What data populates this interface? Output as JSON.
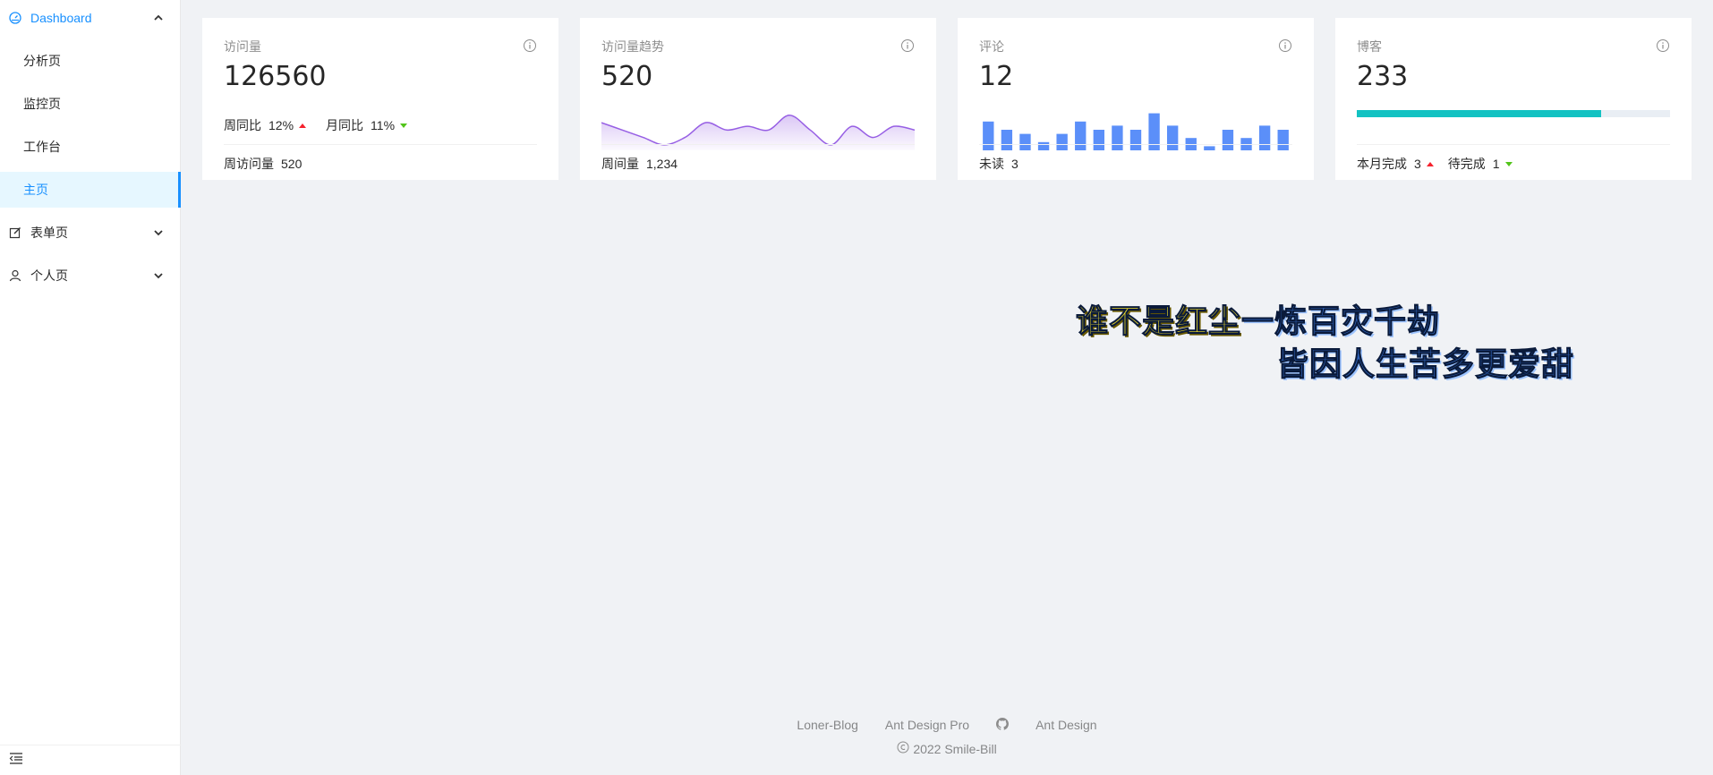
{
  "sidebar": {
    "dashboard_label": "Dashboard",
    "items": [
      {
        "label": "分析页"
      },
      {
        "label": "监控页"
      },
      {
        "label": "工作台"
      },
      {
        "label": "主页"
      }
    ],
    "form_label": "表单页",
    "profile_label": "个人页",
    "accent_color": "#1890ff"
  },
  "cards": {
    "visits": {
      "title": "访问量",
      "value": "126560",
      "week_label": "周同比",
      "week_value": "12%",
      "month_label": "月同比",
      "month_value": "11%",
      "footer_label": "周访问量",
      "footer_value": "520"
    },
    "trend": {
      "title": "访问量趋势",
      "value": "520",
      "footer_label": "周间量",
      "footer_value": "1,234"
    },
    "comments": {
      "title": "评论",
      "value": "12",
      "footer_label": "未读",
      "footer_value": "3"
    },
    "blog": {
      "title": "博客",
      "value": "233",
      "progress": 0.78,
      "done_label": "本月完成",
      "done_value": "3",
      "pending_label": "待完成",
      "pending_value": "1"
    }
  },
  "chart_data": [
    {
      "type": "area",
      "x": [
        1,
        2,
        3,
        4,
        5,
        6,
        7,
        8,
        9,
        10,
        11,
        12,
        13,
        14,
        15,
        16
      ],
      "values": [
        7,
        5,
        3,
        1,
        3,
        7,
        5,
        6,
        5,
        9,
        5,
        1,
        6,
        3,
        6,
        5
      ],
      "color": "#975fe4"
    },
    {
      "type": "bar",
      "categories": [
        "1",
        "2",
        "3",
        "4",
        "5",
        "6",
        "7",
        "8",
        "9",
        "10",
        "11",
        "12",
        "13",
        "14",
        "15",
        "16",
        "17"
      ],
      "values": [
        7,
        5,
        4,
        2,
        4,
        7,
        5,
        6,
        5,
        9,
        6,
        3,
        1,
        5,
        3,
        6,
        5
      ],
      "color": "#5b8ff9"
    }
  ],
  "footer": {
    "links": [
      "Loner-Blog",
      "Ant Design Pro",
      "Ant Design"
    ],
    "copyright": "2022 Smile-Bill"
  },
  "caption": {
    "line1_highlight": "谁不是红尘",
    "line1_rest": "一炼百灾千劫",
    "line2": "皆因人生苦多更爱甜"
  }
}
